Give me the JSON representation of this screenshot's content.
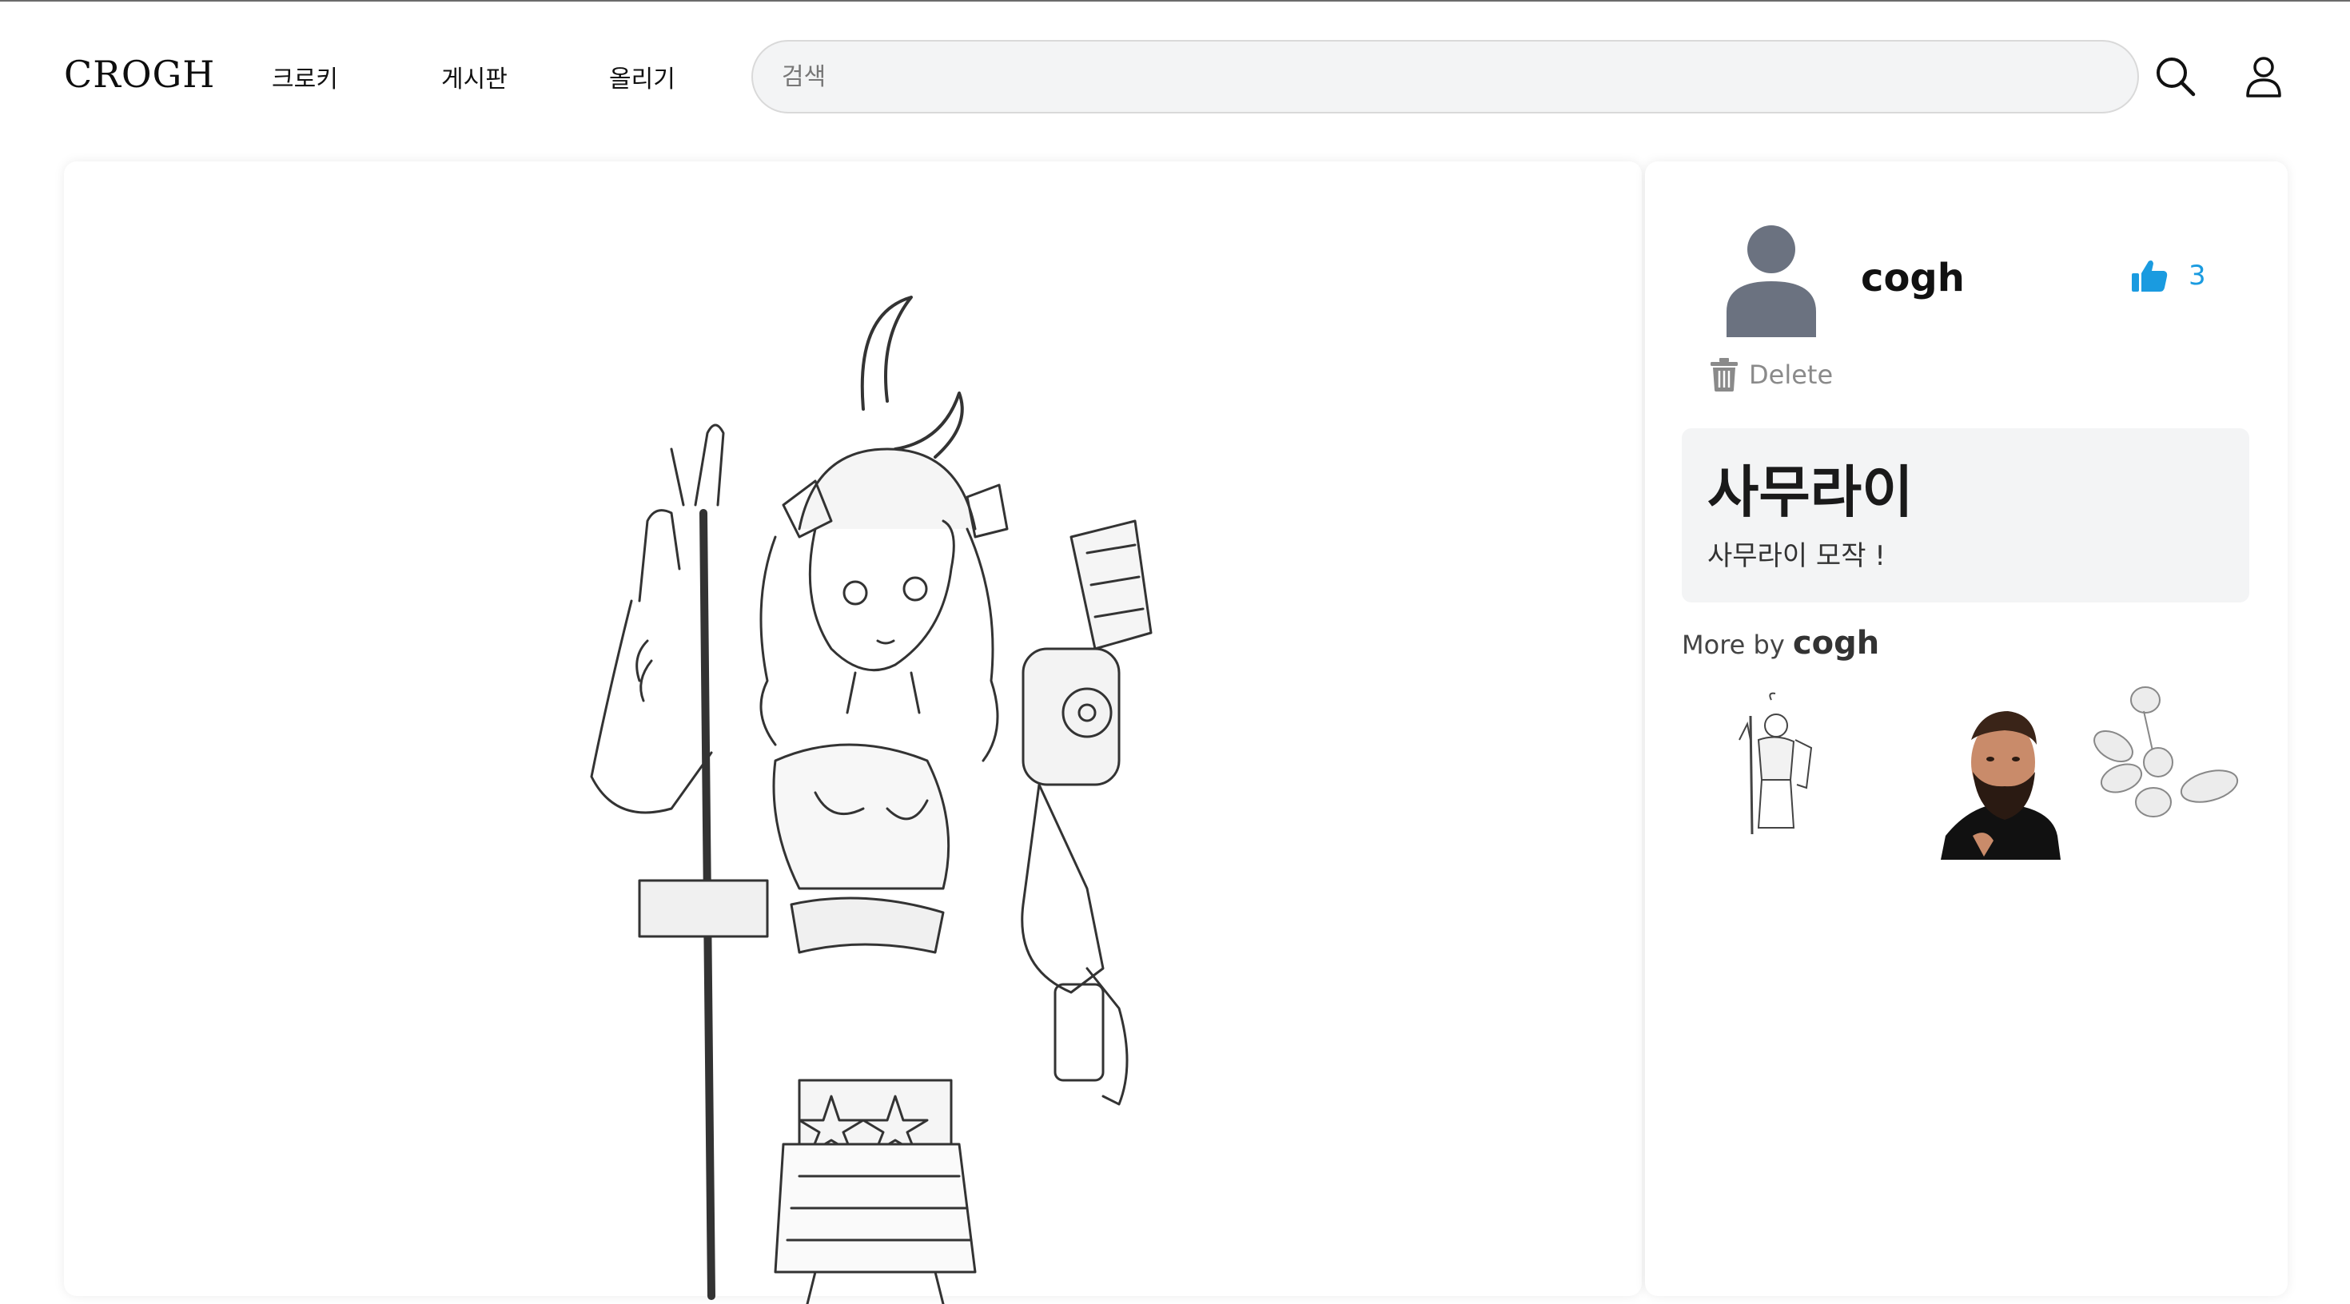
{
  "header": {
    "logo": "CROGH",
    "nav": [
      "크로키",
      "게시판",
      "올리기"
    ],
    "search_placeholder": "검색",
    "search_icon": "search-icon",
    "profile_icon": "user-icon"
  },
  "post": {
    "author": "cogh",
    "likes": "3",
    "delete_label": "Delete",
    "title": "사무라이",
    "description": "사무라이 모작 !"
  },
  "more_by": {
    "prefix": "More by",
    "author": "cogh",
    "thumbnails": [
      "samurai-girl-sketch",
      "bearded-man-portrait",
      "mechanical-arm-sketch"
    ]
  },
  "colors": {
    "accent_like": "#1a9be0",
    "avatar": "#6b7280",
    "panel_bg": "#f3f4f5"
  }
}
